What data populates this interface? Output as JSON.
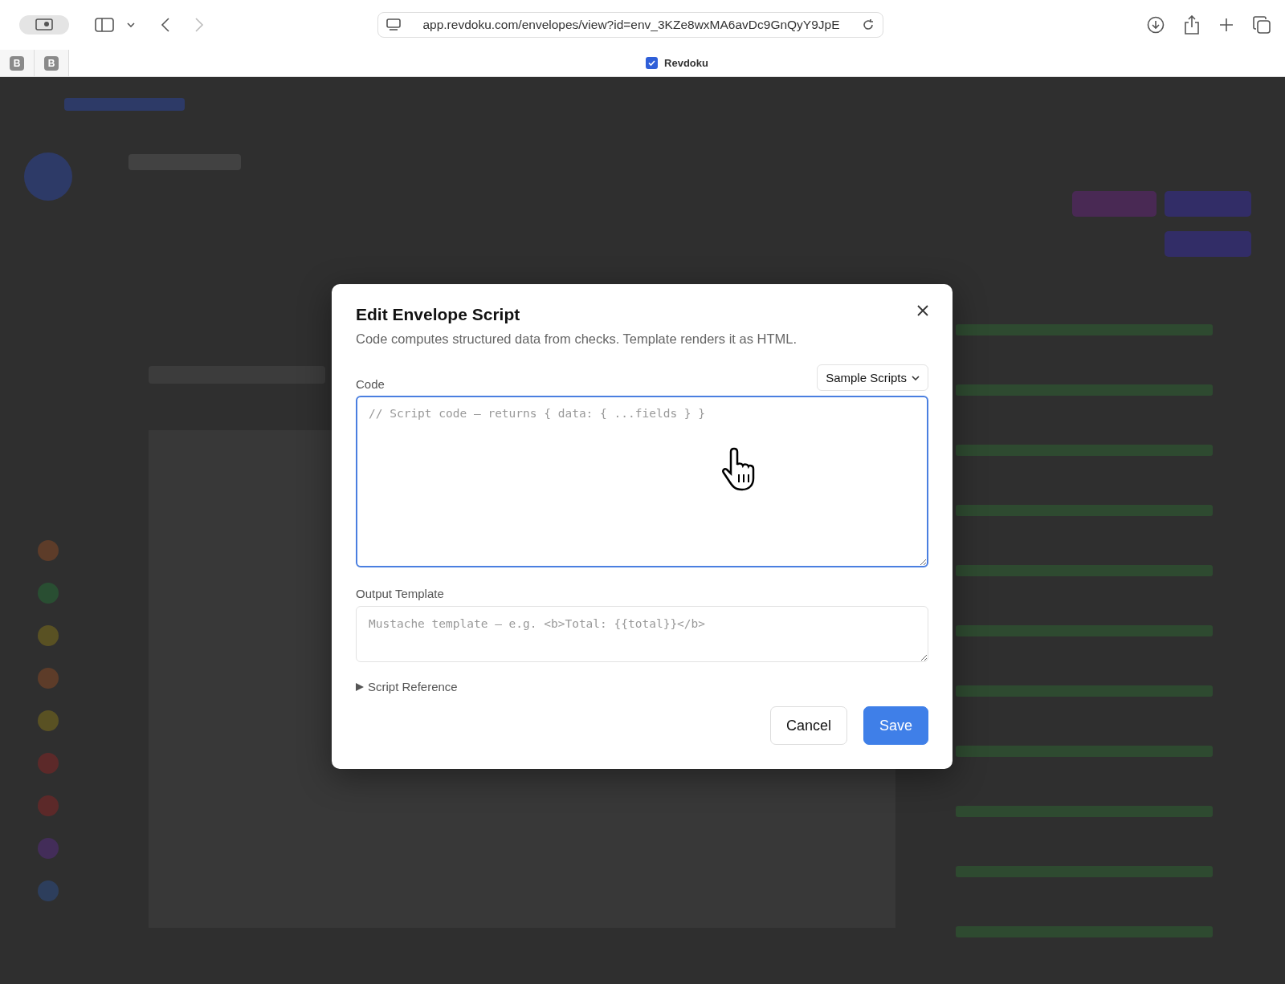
{
  "browser": {
    "url": "app.revdoku.com/envelopes/view?id=env_3KZe8wxMA6avDc9GnQyY9JpE",
    "pinned_tabs": [
      {
        "label": "B"
      },
      {
        "label": "B"
      }
    ],
    "tab": {
      "title": "Revdoku",
      "selected": true
    }
  },
  "dialog": {
    "title": "Edit Envelope Script",
    "subtitle": "Code computes structured data from checks. Template renders it as HTML.",
    "code": {
      "label": "Code",
      "placeholder": "// Script code — returns { data: { ...fields } }",
      "focused": true,
      "samples_button": "Sample Scripts"
    },
    "template": {
      "label": "Output Template",
      "placeholder": "Mustache template — e.g. <b>Total: {{total}}</b>",
      "focused": false
    },
    "reference": {
      "label": "Script Reference",
      "expanded": false
    },
    "buttons": [
      {
        "label": "Cancel",
        "kind": "secondary"
      },
      {
        "label": "Save",
        "kind": "primary"
      }
    ]
  }
}
